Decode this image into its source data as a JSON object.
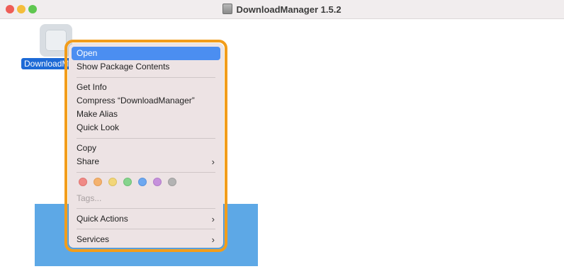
{
  "window": {
    "title": "DownloadManager 1.5.2"
  },
  "file": {
    "label": "DownloadManager"
  },
  "context_menu": {
    "open": "Open",
    "show_package_contents": "Show Package Contents",
    "get_info": "Get Info",
    "compress": "Compress “DownloadManager”",
    "make_alias": "Make Alias",
    "quick_look": "Quick Look",
    "copy": "Copy",
    "share": "Share",
    "tags_placeholder": "Tags...",
    "quick_actions": "Quick Actions",
    "services": "Services",
    "submenu_chevron": "›"
  },
  "tag_colors": {
    "red": "#f08a86",
    "orange": "#f4b26e",
    "yellow": "#f2d679",
    "green": "#86d48d",
    "blue": "#6ea8f0",
    "purple": "#c691dc",
    "gray": "#b3b3b3"
  },
  "colors": {
    "highlight": "#4b8ef1",
    "callout_outline": "#f29d1b",
    "selection_label": "#1d6ad6",
    "background_block": "#5da8e6"
  }
}
